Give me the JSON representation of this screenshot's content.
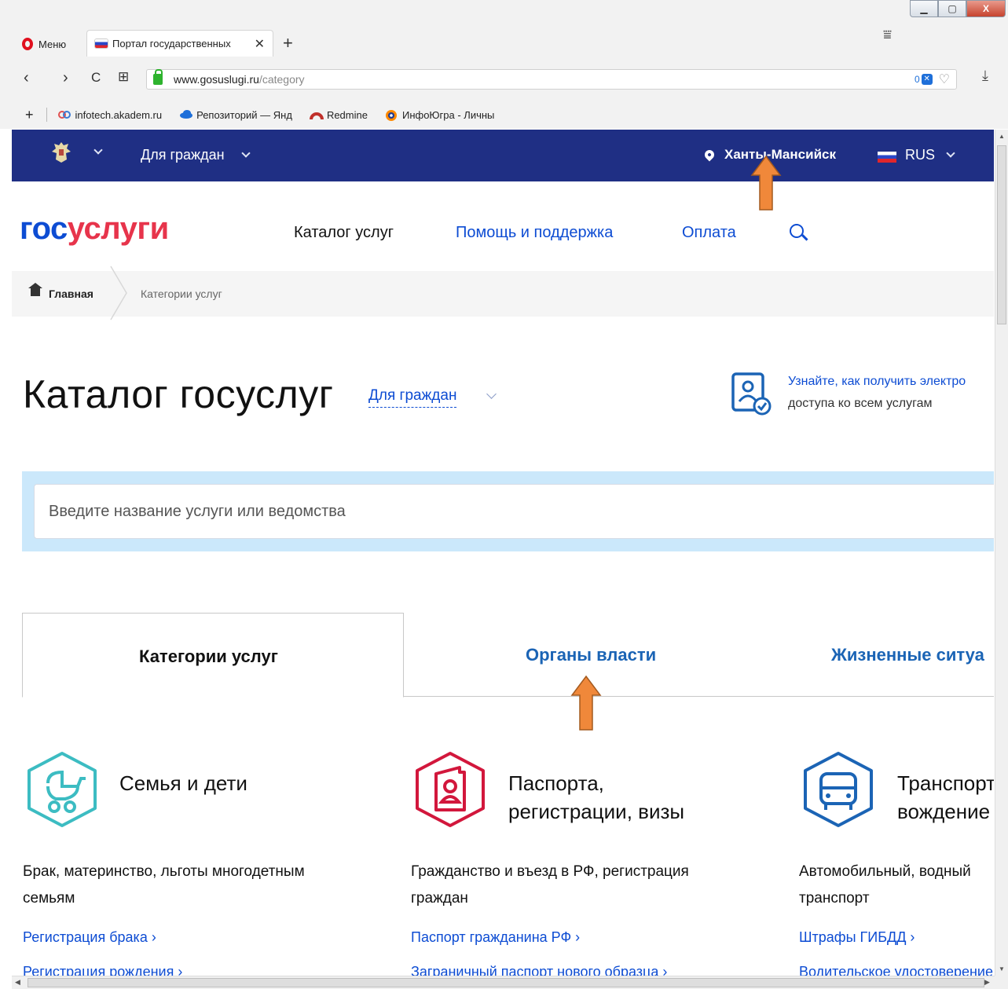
{
  "browser": {
    "menu_label": "Меню",
    "tab_title": "Портал государственных",
    "tab_close": "✕",
    "new_tab": "+",
    "url_host": "www.gosuslugi.ru",
    "url_path": "/category",
    "adblock_count": "0",
    "bookmarks": [
      {
        "label": "infotech.akadem.ru",
        "icon_color": "#e05050"
      },
      {
        "label": "Репозиторий — Янд",
        "icon_color": "#1e6fd9"
      },
      {
        "label": "Redmine",
        "icon_color": "#c0302a"
      },
      {
        "label": "ИнфоЮгра - Личны",
        "icon_color": "#ff8a00"
      }
    ],
    "nav": {
      "back": "‹",
      "forward": "›",
      "reload": "C",
      "speed_dial": "⊞"
    }
  },
  "topbar": {
    "audience": "Для граждан",
    "city": "Ханты-Мансийск",
    "lang": "RUS"
  },
  "header": {
    "logo_part1": "гос",
    "logo_part2": "услуги",
    "nav": [
      "Каталог услуг",
      "Помощь и поддержка",
      "Оплата"
    ]
  },
  "breadcrumb": {
    "home": "Главная",
    "current": "Категории услуг"
  },
  "catalog": {
    "title": "Каталог госуслуг",
    "audience": "Для граждан",
    "info_link": "Узнайте, как получить электро",
    "info_text": "доступа ко всем услугам",
    "search_placeholder": "Введите название услуги или ведомства"
  },
  "tabs": [
    {
      "label": "Категории услуг",
      "active": true
    },
    {
      "label": "Органы власти",
      "active": false
    },
    {
      "label": "Жизненные ситуа",
      "active": false
    }
  ],
  "categories": [
    {
      "title_line1": "Семья и дети",
      "title_line2": "",
      "icon": "baby-stroller-icon",
      "color": "#3cbcc2",
      "desc_line1": "Брак, материнство, льготы многодетным",
      "desc_line2": "семьям",
      "link1": "Регистрация брака ›",
      "link2": "Регистрация рождения ›"
    },
    {
      "title_line1": "Паспорта,",
      "title_line2": "регистрации, визы",
      "icon": "passport-icon",
      "color": "#d2173c",
      "desc_line1": "Гражданство и въезд в РФ, регистрация",
      "desc_line2": "граждан",
      "link1": "Паспорт гражданина РФ ›",
      "link2": "Заграничный паспорт нового образца ›"
    },
    {
      "title_line1": "Транспорт",
      "title_line2": "вождение",
      "icon": "car-icon",
      "color": "#1b64b5",
      "desc_line1": "Автомобильный, водный",
      "desc_line2": "транспорт",
      "link1": "Штрафы ГИБДД ›",
      "link2": "Водительское удостоверение ›"
    }
  ],
  "colors": {
    "brand_blue": "#0d4cd3",
    "brand_red": "#e7344b",
    "topbar": "#1f2f84",
    "annotation_arrow": "#f0883a"
  }
}
